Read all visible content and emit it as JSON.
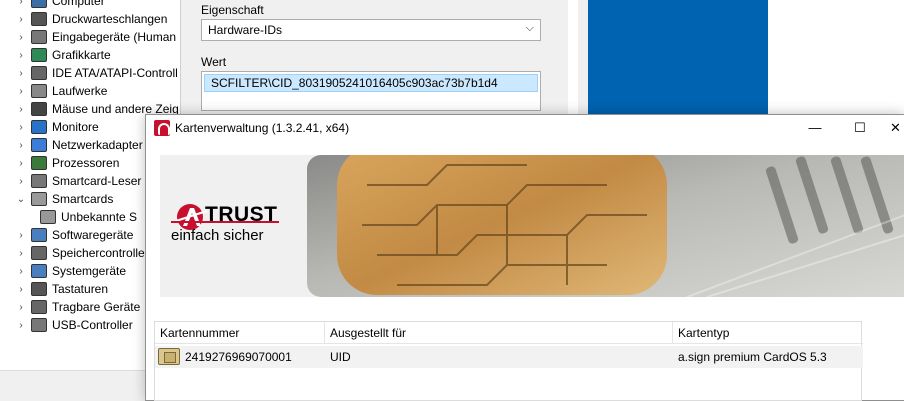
{
  "device_manager": {
    "items": [
      {
        "label": "Computer",
        "expanded": false,
        "icon": "computer-icon"
      },
      {
        "label": "Druckwarteschlangen",
        "expanded": false,
        "icon": "printer-icon"
      },
      {
        "label": "Eingabegeräte (Human",
        "expanded": false,
        "icon": "hid-icon"
      },
      {
        "label": "Grafikkarte",
        "expanded": false,
        "icon": "display-adapter-icon"
      },
      {
        "label": "IDE ATA/ATAPI-Controll",
        "expanded": false,
        "icon": "ide-controller-icon"
      },
      {
        "label": "Laufwerke",
        "expanded": false,
        "icon": "disk-drive-icon"
      },
      {
        "label": "Mäuse und andere Zeig",
        "expanded": false,
        "icon": "mouse-icon"
      },
      {
        "label": "Monitore",
        "expanded": false,
        "icon": "monitor-icon"
      },
      {
        "label": "Netzwerkadapter",
        "expanded": false,
        "icon": "network-adapter-icon"
      },
      {
        "label": "Prozessoren",
        "expanded": false,
        "icon": "processor-icon"
      },
      {
        "label": "Smartcard-Leser",
        "expanded": false,
        "icon": "smartcard-reader-icon"
      },
      {
        "label": "Smartcards",
        "expanded": true,
        "icon": "smartcard-icon"
      },
      {
        "label": "Unbekannte S",
        "child": true,
        "icon": "smartcard-icon"
      },
      {
        "label": "Softwaregeräte",
        "expanded": false,
        "icon": "software-device-icon"
      },
      {
        "label": "Speichercontrolle",
        "expanded": false,
        "icon": "storage-controller-icon"
      },
      {
        "label": "Systemgeräte",
        "expanded": false,
        "icon": "system-device-icon"
      },
      {
        "label": "Tastaturen",
        "expanded": false,
        "icon": "keyboard-icon"
      },
      {
        "label": "Tragbare Geräte",
        "expanded": false,
        "icon": "portable-device-icon"
      },
      {
        "label": "USB-Controller",
        "expanded": false,
        "icon": "usb-icon"
      }
    ]
  },
  "properties": {
    "property_label": "Eigenschaft",
    "property_value": "Hardware-IDs",
    "value_label": "Wert",
    "value_item": "SCFILTER\\CID_8031905241016405c903ac73b7b1d4"
  },
  "card_manager": {
    "title": "Kartenverwaltung (1.3.2.41, x64)",
    "minimize": "—",
    "maximize": "☐",
    "close": "✕",
    "logo_brand": "TRUST",
    "logo_slogan": "einfach sicher",
    "table": {
      "headers": [
        "Kartennummer",
        "Ausgestellt für",
        "Kartentyp"
      ],
      "rows": [
        {
          "number": "2419276969070001",
          "issued_for": "UID",
          "type": "a.sign premium CardOS 5.3"
        }
      ]
    }
  },
  "colors": {
    "brand_red": "#c8102e",
    "selection_blue": "#cce8ff",
    "desktop_blue": "#0063b1"
  }
}
